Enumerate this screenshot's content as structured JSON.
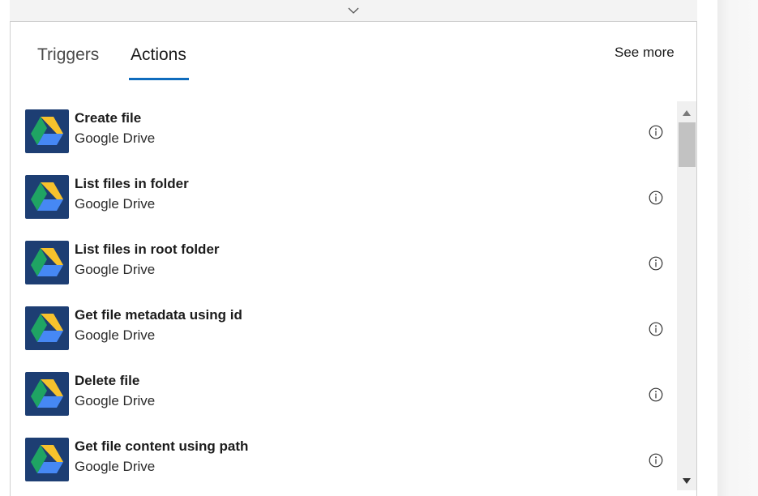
{
  "panel": {
    "collapse_icon": "chevron-down-icon",
    "tabs": [
      {
        "label": "Triggers",
        "selected": false
      },
      {
        "label": "Actions",
        "selected": true
      }
    ],
    "see_more_label": "See more",
    "accent_color": "#0f6cbd"
  },
  "actions": [
    {
      "title": "Create file",
      "connector": "Google Drive",
      "icon": "google-drive-icon",
      "info_icon": "info-icon"
    },
    {
      "title": "List files in folder",
      "connector": "Google Drive",
      "icon": "google-drive-icon",
      "info_icon": "info-icon"
    },
    {
      "title": "List files in root folder",
      "connector": "Google Drive",
      "icon": "google-drive-icon",
      "info_icon": "info-icon"
    },
    {
      "title": "Get file metadata using id",
      "connector": "Google Drive",
      "icon": "google-drive-icon",
      "info_icon": "info-icon"
    },
    {
      "title": "Delete file",
      "connector": "Google Drive",
      "icon": "google-drive-icon",
      "info_icon": "info-icon"
    },
    {
      "title": "Get file content using path",
      "connector": "Google Drive",
      "icon": "google-drive-icon",
      "info_icon": "info-icon"
    }
  ],
  "icon_colors": {
    "tile_background": "#1d3e73",
    "drive_yellow": "#f7c22c",
    "drive_green": "#1fa463",
    "drive_blue": "#4688f4"
  }
}
